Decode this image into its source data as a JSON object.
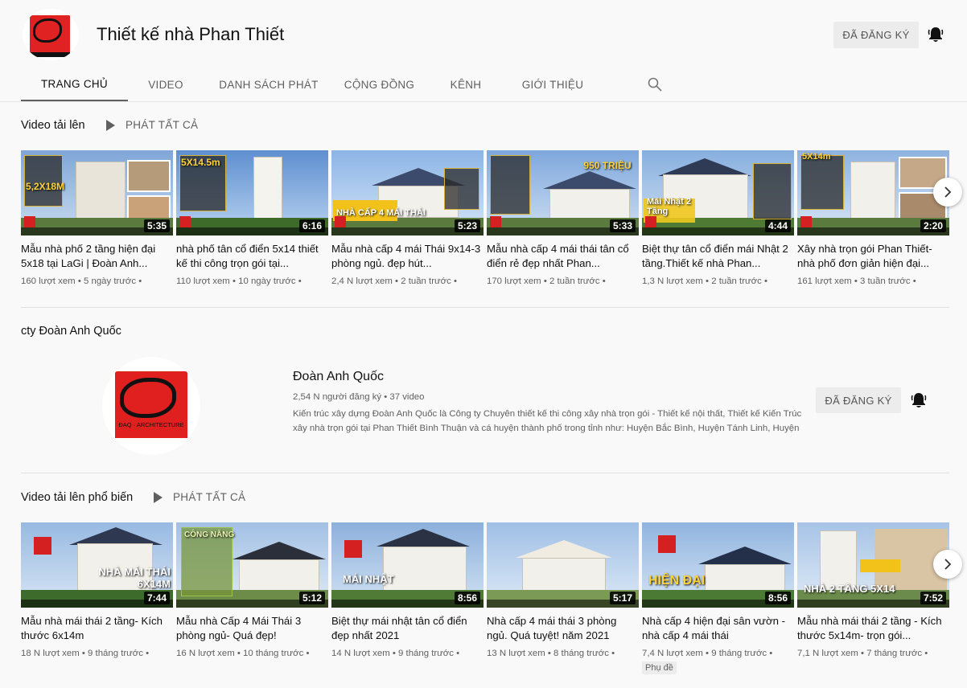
{
  "channel": {
    "title": "Thiết kế nhà Phan Thiết",
    "subscribe_label": "ĐÃ ĐĂNG KÝ",
    "tabs": [
      {
        "label": "TRANG CHỦ"
      },
      {
        "label": "VIDEO"
      },
      {
        "label": "DANH SÁCH PHÁT"
      },
      {
        "label": "CỘNG ĐỒNG"
      },
      {
        "label": "KÊNH"
      },
      {
        "label": "GIỚI THIỆU"
      }
    ]
  },
  "uploads": {
    "title": "Video tải lên",
    "play_all": "PHÁT TẤT CẢ",
    "videos": [
      {
        "title": "Mẫu nhà phố 2 tầng hiện đại 5x18 tại LaGi | Đoàn Anh...",
        "views": "160 lượt xem",
        "age": "5 ngày trước",
        "duration": "5:35",
        "overlay": "5,2X18M"
      },
      {
        "title": "nhà phố tân cổ điển 5x14 thiết kế thi công trọn gói tại...",
        "views": "110 lượt xem",
        "age": "10 ngày trước",
        "duration": "6:16",
        "overlay": "5X14.5m"
      },
      {
        "title": "Mẫu nhà cấp 4 mái Thái 9x14-3 phòng ngủ. đẹp hút...",
        "views": "2,4 N lượt xem",
        "age": "2 tuần trước",
        "duration": "5:23",
        "overlay": "NHÀ CẤP 4 MÁI THÁI"
      },
      {
        "title": "Mẫu nhà cấp 4 mái thái tân cổ điển rẻ đẹp nhất Phan...",
        "views": "170 lượt xem",
        "age": "2 tuần trước",
        "duration": "5:33",
        "overlay": "950 TRIỆU"
      },
      {
        "title": "Biệt thự tân cổ điển mái Nhật 2 tầng.Thiết kế nhà Phan...",
        "views": "1,3 N lượt xem",
        "age": "2 tuần trước",
        "duration": "4:44",
        "overlay": "Mái Nhật 2 Tầng"
      },
      {
        "title": "Xây nhà trọn gói Phan Thiết-nhà phố đơn giản hiện đại...",
        "views": "161 lượt xem",
        "age": "3 tuần trước",
        "duration": "2:20",
        "overlay": "5X14m"
      }
    ]
  },
  "featured_channel": {
    "section_title": "cty Đoàn Anh Quốc",
    "name": "Đoàn Anh Quốc",
    "stats": "2,54 N người đăng ký • 37 video",
    "description": "Kiến trúc xây dựng Đoàn Anh Quốc là Công ty Chuyên thiết kế thi công xây nhà trọn gói - Thiết kế nội thất, Thiết kế Kiến Trúc xây nhà trọn gói tại Phan Thiết Bình Thuận và cá huyện thành phố trong tỉnh như: Huyện Bắc Bình, Huyện Tánh Linh, Huyện Đức Linh, Huyện",
    "subscribe_label": "ĐÃ ĐĂNG KÝ",
    "logo_text": "ĐAQ · ARCHITECTURE"
  },
  "popular": {
    "title": "Video tải lên phổ biến",
    "play_all": "PHÁT TẤT CẢ",
    "videos": [
      {
        "title": "Mẫu nhà mái thái 2 tầng- Kích thước 6x14m",
        "views": "18 N lượt xem",
        "age": "9 tháng trước",
        "duration": "7:44",
        "overlay": "NHÀ MÁI THÁI 6X14M",
        "cc": ""
      },
      {
        "title": "Mẫu nhà Cấp 4 Mái Thái 3 phòng ngủ- Quá đẹp!",
        "views": "16 N lượt xem",
        "age": "10 tháng trước",
        "duration": "5:12",
        "overlay": "CÔNG NĂNG",
        "cc": ""
      },
      {
        "title": "Biệt thự mái nhật tân cổ điển đẹp nhất 2021",
        "views": "14 N lượt xem",
        "age": "9 tháng trước",
        "duration": "8:56",
        "overlay": "MÁI NHẬT",
        "cc": ""
      },
      {
        "title": "Nhà cấp 4 mái thái 3 phòng ngủ. Quá tuyệt! năm 2021",
        "views": "13 N lượt xem",
        "age": "8 tháng trước",
        "duration": "5:17",
        "overlay": "",
        "cc": ""
      },
      {
        "title": "Nhà cấp 4 hiện đại sân vườn - nhà cấp 4 mái thái",
        "views": "7,4 N lượt xem",
        "age": "9 tháng trước",
        "duration": "8:56",
        "overlay": "HIỆN ĐẠI",
        "cc": "Phụ đề"
      },
      {
        "title": "Mẫu nhà mái thái 2 tầng - Kích thước 5x14m- trọn gói...",
        "views": "7,1 N lượt xem",
        "age": "7 tháng trước",
        "duration": "7:52",
        "overlay": "NHÀ 2 TẦNG 5X14",
        "cc": ""
      }
    ]
  },
  "colors": {
    "accent_red": "#e12222",
    "meta": "#606060"
  },
  "icons": {
    "bell": "bell-icon",
    "search": "search-icon",
    "next": "chevron-right-icon",
    "play": "play-icon"
  }
}
